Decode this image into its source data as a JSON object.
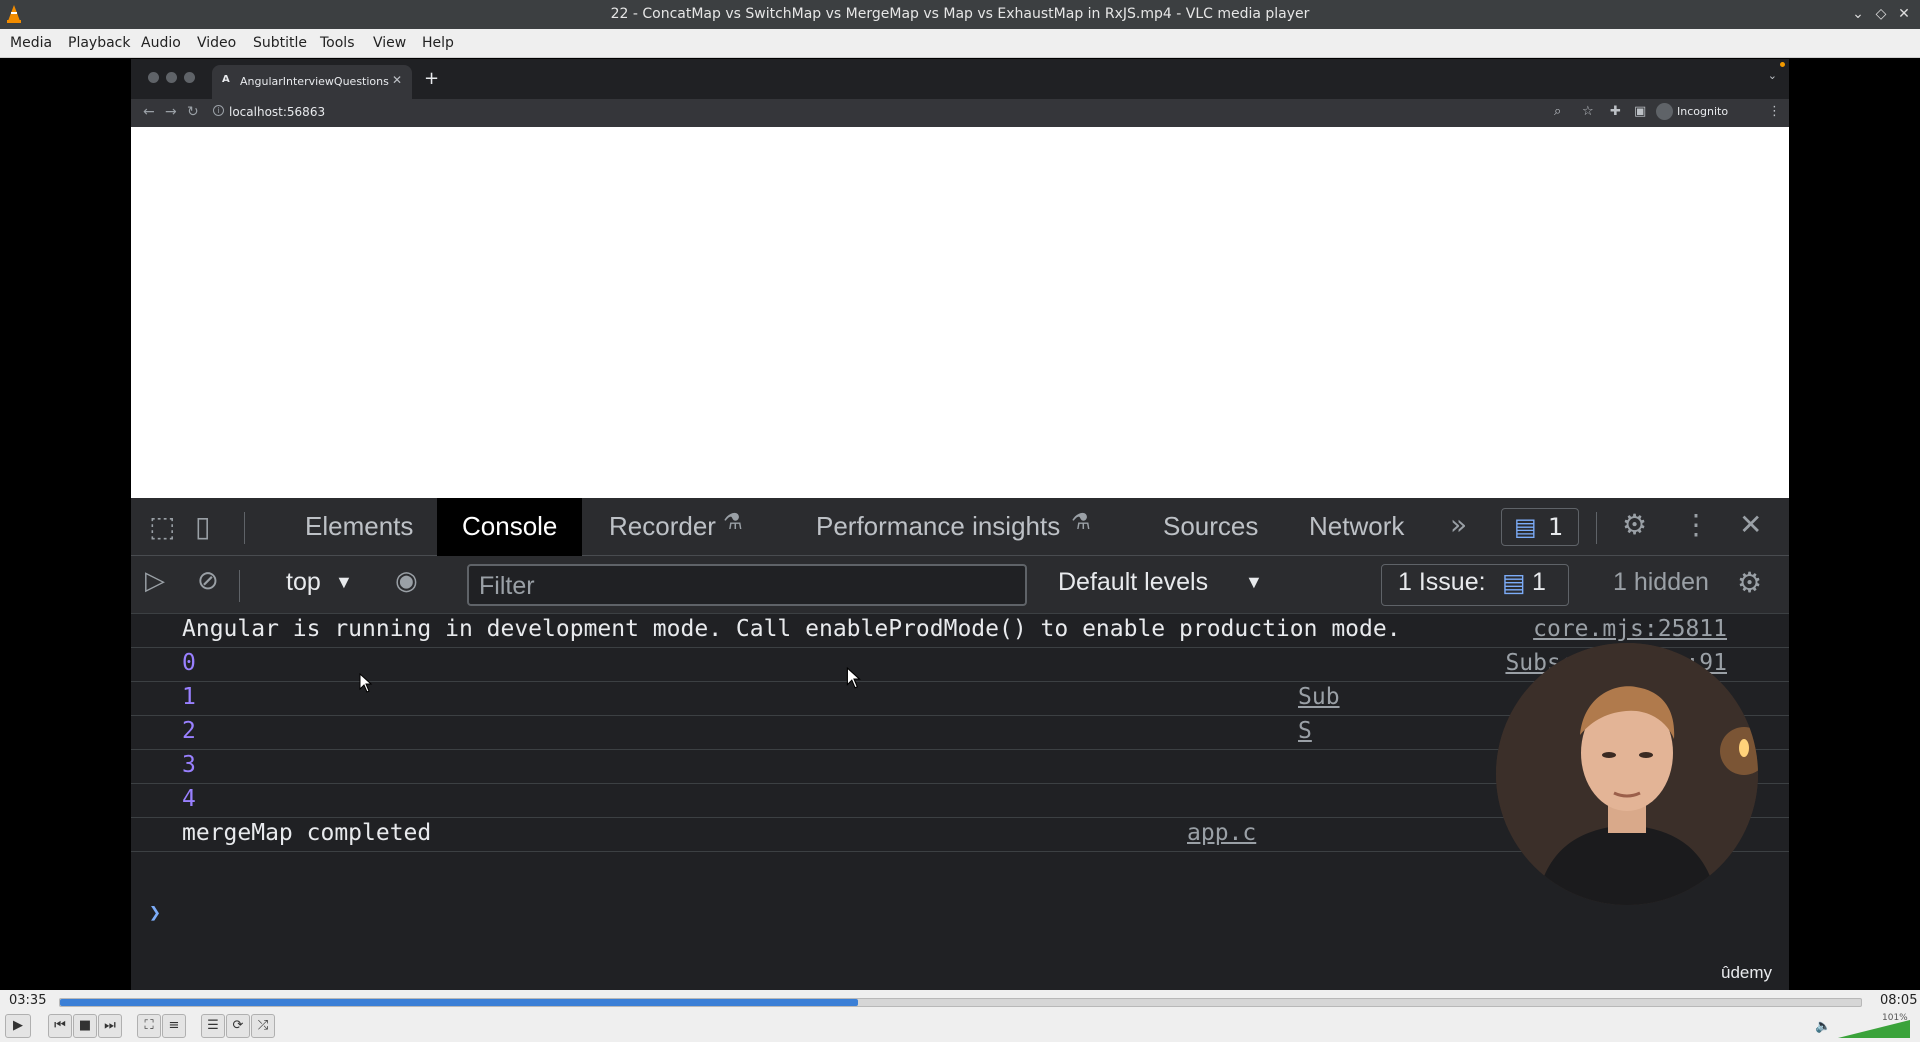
{
  "window": {
    "title": "22 - ConcatMap vs SwitchMap vs MergeMap vs Map vs ExhaustMap in RxJS.mp4 - VLC media player",
    "controls": [
      "minimize-icon",
      "maximize-icon",
      "close-icon"
    ]
  },
  "menu": {
    "items": [
      "Media",
      "Playback",
      "Audio",
      "Video",
      "Subtitle",
      "Tools",
      "View",
      "Help"
    ]
  },
  "browser": {
    "tab_title": "AngularInterviewQuestions",
    "tab_favicon": "A",
    "url": "localhost:56863",
    "profile_label": "Incognito"
  },
  "devtools": {
    "tabs": [
      "Elements",
      "Console",
      "Recorder",
      "Performance insights",
      "Sources",
      "Network"
    ],
    "active_tab": "Console",
    "issues_badge_count": "1",
    "context": "top",
    "filter_placeholder": "Filter",
    "levels": "Default levels",
    "issues_label": "1 Issue:",
    "issues_count": "1",
    "hidden_label": "1 hidden",
    "console_rows": [
      {
        "message": "Angular is running in development mode. Call enableProdMode() to enable production mode.",
        "source": "core.mjs:25811",
        "numeric": false
      },
      {
        "message": "0",
        "source": "Subscriber.js:91",
        "numeric": true
      },
      {
        "message": "1",
        "source": "Sub",
        "numeric": true
      },
      {
        "message": "2",
        "source": "S",
        "numeric": true
      },
      {
        "message": "3",
        "source": "",
        "numeric": true
      },
      {
        "message": "4",
        "source": "",
        "numeric": true
      },
      {
        "message": "mergeMap completed",
        "source": "app.c",
        "numeric": false
      }
    ]
  },
  "watermark": "ûdemy",
  "player": {
    "elapsed": "03:35",
    "total": "08:05",
    "progress": 0.443,
    "volume_label": "101%",
    "volume_level": 1.01,
    "accent_color": "#3b7fd6"
  }
}
